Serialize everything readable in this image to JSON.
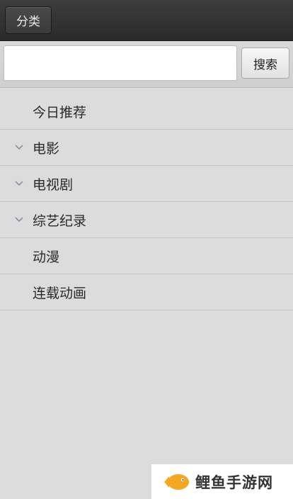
{
  "header": {
    "category_label": "分类"
  },
  "search": {
    "value": "",
    "placeholder": "",
    "button_label": "搜索"
  },
  "menu": {
    "items": [
      {
        "label": "今日推荐",
        "expandable": false
      },
      {
        "label": "电影",
        "expandable": true
      },
      {
        "label": "电视剧",
        "expandable": true
      },
      {
        "label": "综艺纪录",
        "expandable": true
      },
      {
        "label": "动漫",
        "expandable": false
      },
      {
        "label": "连载动画",
        "expandable": false
      }
    ]
  },
  "watermark": {
    "text": "鲤鱼手游网"
  },
  "colors": {
    "background": "#dcdcdc",
    "topbar": "#2f2f2f",
    "watermark_fish": "#f5a623"
  }
}
